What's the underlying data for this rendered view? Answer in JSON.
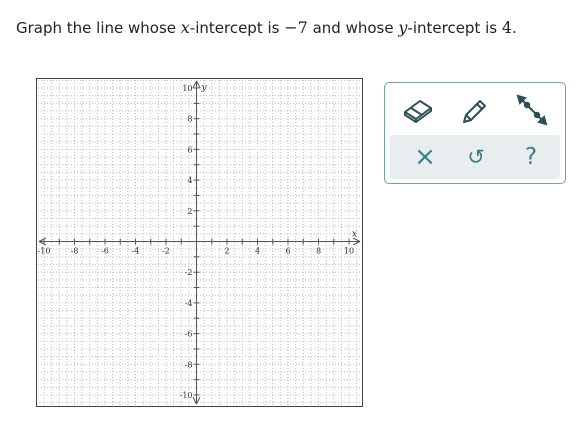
{
  "question": {
    "part1": "Graph the line whose ",
    "var_x": "x",
    "part2": "-intercept is ",
    "value1": "−7",
    "part3": " and whose ",
    "var_y": "y",
    "part4": "-intercept is ",
    "value2": "4",
    "part5": "."
  },
  "graph": {
    "x_axis_label": "x",
    "y_axis_label": "y",
    "x_range": [
      -10,
      10
    ],
    "y_range": [
      -10,
      10
    ],
    "grid": true,
    "x_tick_labels": [
      "-10",
      "-8",
      "-6",
      "-4",
      "-2",
      "2",
      "4",
      "6",
      "8",
      "10"
    ],
    "y_tick_labels": [
      "10",
      "8",
      "6",
      "4",
      "2",
      "-2",
      "-4",
      "-6",
      "-8",
      "-10"
    ]
  },
  "tools": {
    "items": [
      {
        "icon": "eraser-icon"
      },
      {
        "icon": "pencil-icon"
      },
      {
        "icon": "line-tool-icon"
      }
    ]
  },
  "actions": {
    "clear_glyph": "×",
    "undo_glyph": "↺",
    "help_glyph": "?"
  },
  "colors": {
    "accent": "#3f7d87",
    "tool_icon": "#2f4f55",
    "panel_border": "#6fa3a8",
    "action_bar_bg": "#e8eef0",
    "grid": "#bdbdbd",
    "axis": "#555555"
  }
}
